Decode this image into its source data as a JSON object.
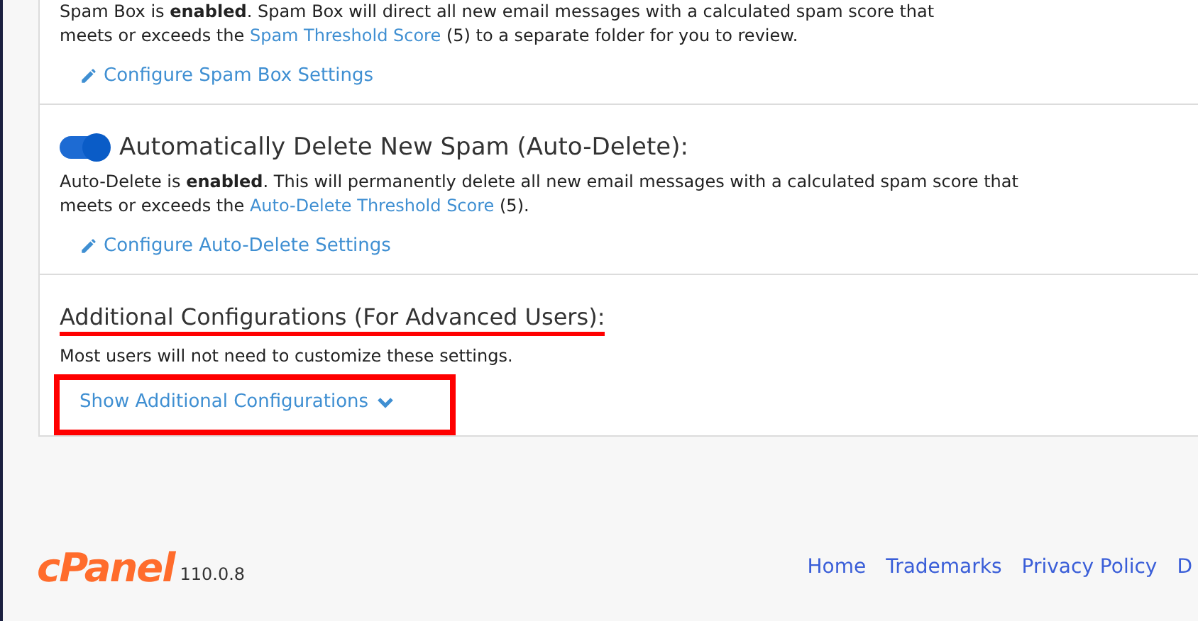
{
  "sections": [
    {
      "kind": "spam_box",
      "description": "Spam Box is **enabled**. Spam Box will direct all new email messages with a calculated spam score that",
      "description_2": "meets or exceeds the",
      "threshold_link": "Spam Threshold Score",
      "after": "(5) to a separate folder for you to review.",
      "configure_link": "Configure Spam Box Settings"
    },
    {
      "kind": "toggle",
      "on": true,
      "title": "Automatically Delete New Spam (Auto-Delete):",
      "description": "Auto-Delete is **enabled**. This will permanently delete all new email messages with a calculated spam score that meets or exceeds the",
      "threshold_link": "Auto-Delete Threshold Score",
      "after": "(5).",
      "configure_link": "Configure Auto-Delete Settings"
    },
    {
      "kind": "advanced",
      "title": "Additional Configurations (For Advanced Users):",
      "description": "Most users will not need to customize these settings.",
      "expand_link": "Show Additional Configurations"
    }
  ],
  "footer": {
    "logo": "cPanel",
    "version": "110.0.8",
    "links": [
      "Home",
      "Trademarks",
      "Privacy Policy",
      "D"
    ]
  }
}
